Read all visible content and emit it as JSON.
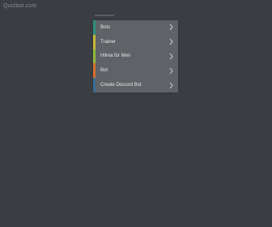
{
  "header": {
    "logo_text": "Quizbot.com"
  },
  "menu": {
    "items": [
      {
        "label": "Bots",
        "accent_color": "#2f8f7e",
        "icon": "chevron-right-icon"
      },
      {
        "label": "Trainer",
        "accent_color": "#c7b63a",
        "icon": "chevron-right-icon"
      },
      {
        "label": "Hilma für Men",
        "accent_color": "#8fb83a",
        "icon": "chevron-right-icon"
      },
      {
        "label": "Bot",
        "accent_color": "#d6702f",
        "icon": "chevron-right-icon"
      },
      {
        "label": "Create Discord Bot",
        "accent_color": "#3a6d96",
        "icon": "chevron-right-icon"
      }
    ]
  }
}
